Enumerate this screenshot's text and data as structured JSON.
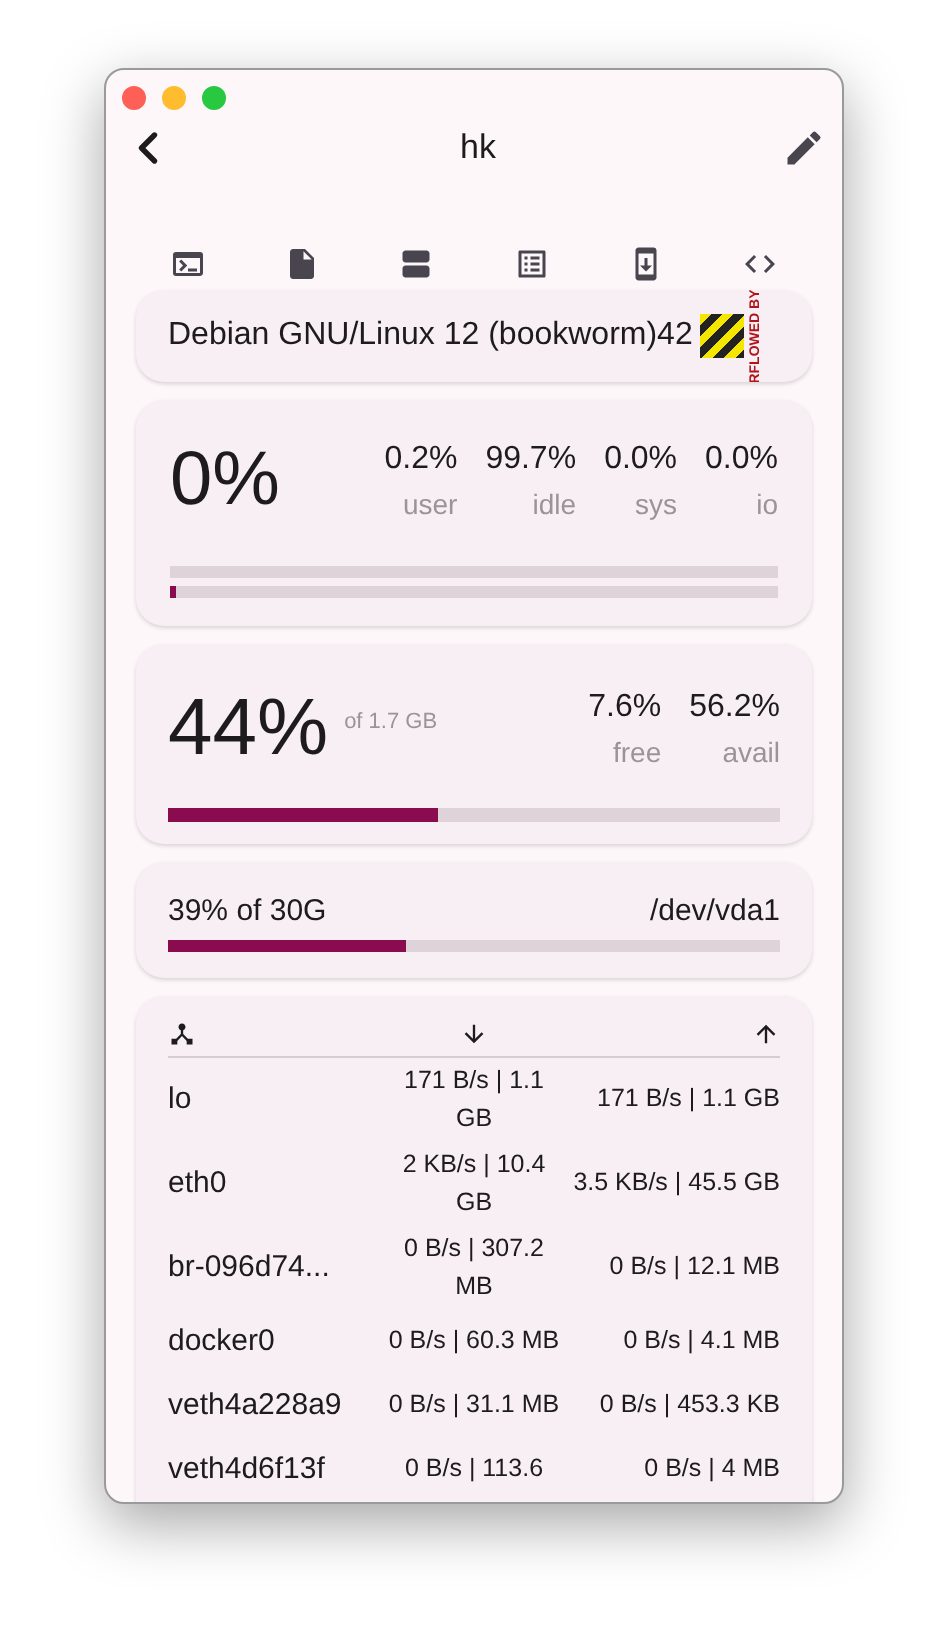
{
  "window": {
    "title": "hk"
  },
  "toolbar": [
    {
      "kind": "terminal"
    },
    {
      "kind": "file"
    },
    {
      "kind": "storage"
    },
    {
      "kind": "table"
    },
    {
      "kind": "download"
    },
    {
      "kind": "code"
    }
  ],
  "os": {
    "text": "Debian GNU/Linux 12 (bookworm)42",
    "overflow_label": "RFLOWED BY"
  },
  "cpu": {
    "total": "0%",
    "stats": [
      {
        "value": "0.2%",
        "label": "user"
      },
      {
        "value": "99.7%",
        "label": "idle"
      },
      {
        "value": "0.0%",
        "label": "sys"
      },
      {
        "value": "0.0%",
        "label": "io"
      }
    ],
    "bars": [
      {
        "level": 0
      },
      {
        "level": 0.01
      }
    ]
  },
  "memory": {
    "used": "44%",
    "of": "of 1.7 GB",
    "stats": [
      {
        "value": "7.6%",
        "label": "free"
      },
      {
        "value": "56.2%",
        "label": "avail"
      }
    ],
    "level": 0.44
  },
  "disk": {
    "usage": "39% of 30G",
    "device": "/dev/vda1",
    "level": 0.39
  },
  "network": {
    "rows": [
      {
        "name": "lo",
        "rx": "171 B/s | 1.1 GB",
        "tx": "171 B/s | 1.1 GB"
      },
      {
        "name": "eth0",
        "rx": "2 KB/s | 10.4 GB",
        "tx": "3.5 KB/s | 45.5 GB"
      },
      {
        "name": "br-096d74...",
        "rx": "0 B/s | 307.2 MB",
        "tx": "0 B/s | 12.1 MB"
      },
      {
        "name": "docker0",
        "rx": "0 B/s | 60.3 MB",
        "tx": "0 B/s | 4.1 MB"
      },
      {
        "name": "veth4a228a9",
        "rx": "0 B/s | 31.1 MB",
        "tx": "0 B/s | 453.3 KB"
      },
      {
        "name": "veth4d6f13f",
        "rx": "0 B/s | 113.6",
        "tx": "0 B/s | 4 MB"
      }
    ]
  }
}
